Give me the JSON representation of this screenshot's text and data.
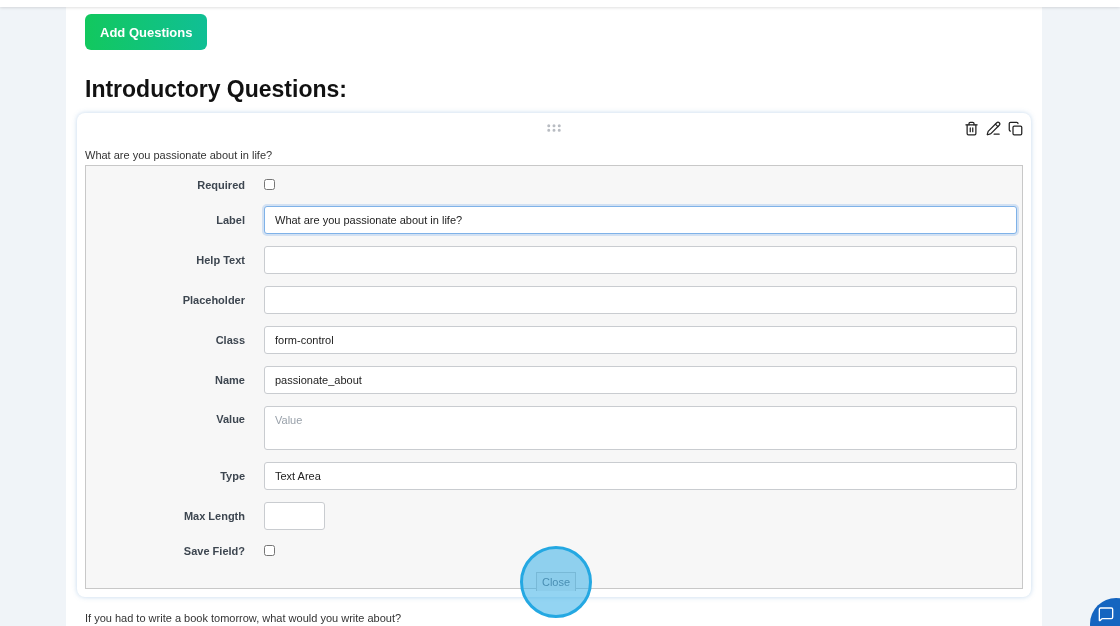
{
  "add_button": "Add Questions",
  "section_title": "Introductory Questions:",
  "questions": [
    {
      "text": "What are you passionate about in life?",
      "expanded": true,
      "fields": [
        {
          "kind": "checkbox",
          "label": "Required",
          "checked": false
        },
        {
          "kind": "text",
          "label": "Label",
          "value": "What are you passionate about in life?",
          "focused": true
        },
        {
          "kind": "text",
          "label": "Help Text",
          "focused": false
        },
        {
          "kind": "text",
          "label": "Placeholder",
          "focused": false
        },
        {
          "kind": "text",
          "label": "Class",
          "value": "form-control",
          "focused": false
        },
        {
          "kind": "text",
          "label": "Name",
          "value": "passionate_about",
          "focused": false
        },
        {
          "kind": "textarea",
          "label": "Value",
          "placeholder": "Value",
          "focused": false
        },
        {
          "kind": "text",
          "label": "Type",
          "value": "Text Area",
          "focused": false
        },
        {
          "kind": "short",
          "label": "Max Length",
          "focused": false
        },
        {
          "kind": "checkbox",
          "label": "Save Field?",
          "checked": false
        }
      ],
      "close_button": "Close"
    },
    {
      "text": "If you had to write a book tomorrow, what would you write about?",
      "expanded": false
    }
  ]
}
